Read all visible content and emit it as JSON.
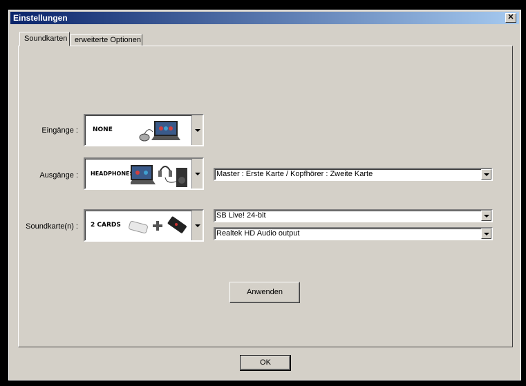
{
  "window": {
    "title": "Einstellungen",
    "close_glyph": "✕"
  },
  "tabs": [
    {
      "label": "Soundkarten",
      "active": true
    },
    {
      "label": "erweiterte Optionen",
      "active": false
    }
  ],
  "inputs_row": {
    "label": "Eingänge :",
    "image_text": "NONE"
  },
  "outputs_row": {
    "label": "Ausgänge :",
    "image_text": "HEADPHONES",
    "mode_value": "Master : Erste Karte / Kopfhörer : Zweite Karte"
  },
  "soundcard_row": {
    "label": "Soundkarte(n) :",
    "image_text": "2 CARDS",
    "card1_value": "SB Live! 24-bit",
    "card2_value": "Realtek HD Audio output"
  },
  "buttons": {
    "apply": "Anwenden",
    "ok": "OK"
  }
}
